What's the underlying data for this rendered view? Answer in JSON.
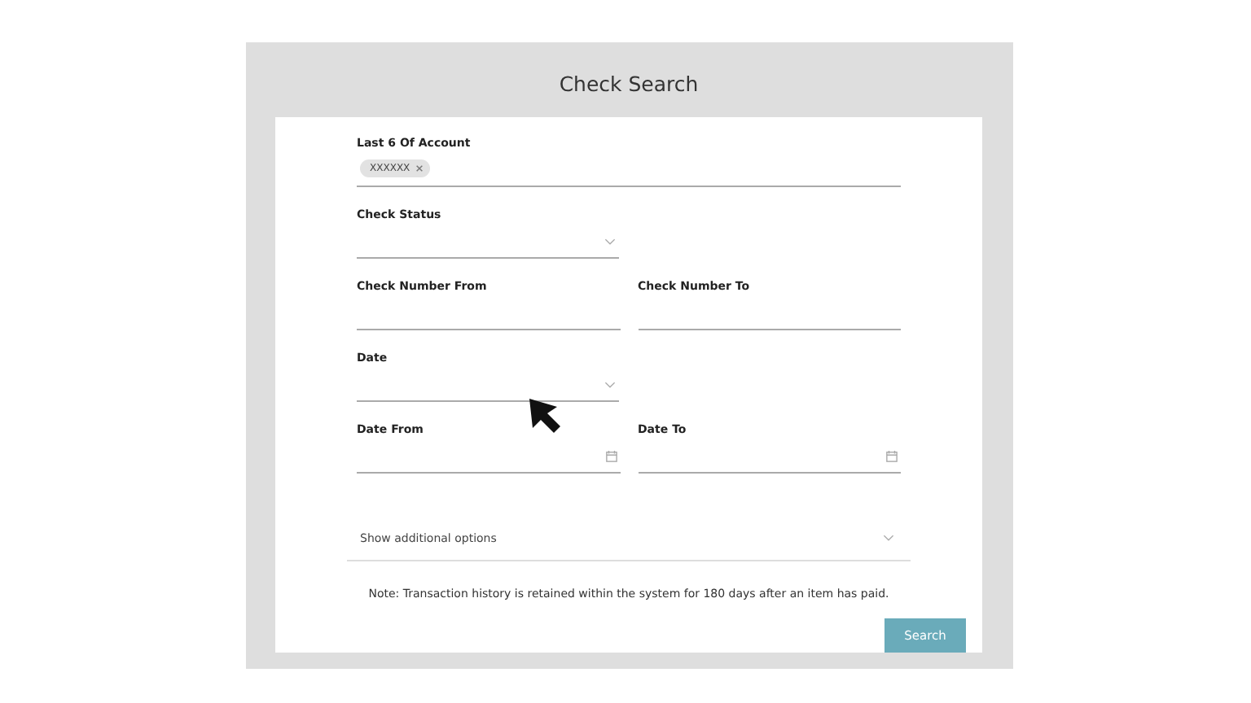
{
  "title": "Check Search",
  "rows": [
    [
      {
        "kind": "tags",
        "label": "Last 6 Of Account",
        "tags": [
          "XXXXXX"
        ]
      }
    ],
    [
      {
        "kind": "select",
        "label": "Check Status"
      }
    ],
    [
      {
        "kind": "text",
        "label": "Check Number From"
      },
      {
        "kind": "text",
        "label": "Check Number To"
      }
    ],
    [
      {
        "kind": "select",
        "label": "Date"
      }
    ],
    [
      {
        "kind": "date",
        "label": "Date From"
      },
      {
        "kind": "date",
        "label": "Date To"
      }
    ]
  ],
  "additional_options": {
    "label": "Show additional options",
    "expanded": false
  },
  "note": "Note: Transaction history is retained within the system for 180 days after an item has paid.",
  "search_button": "Search"
}
